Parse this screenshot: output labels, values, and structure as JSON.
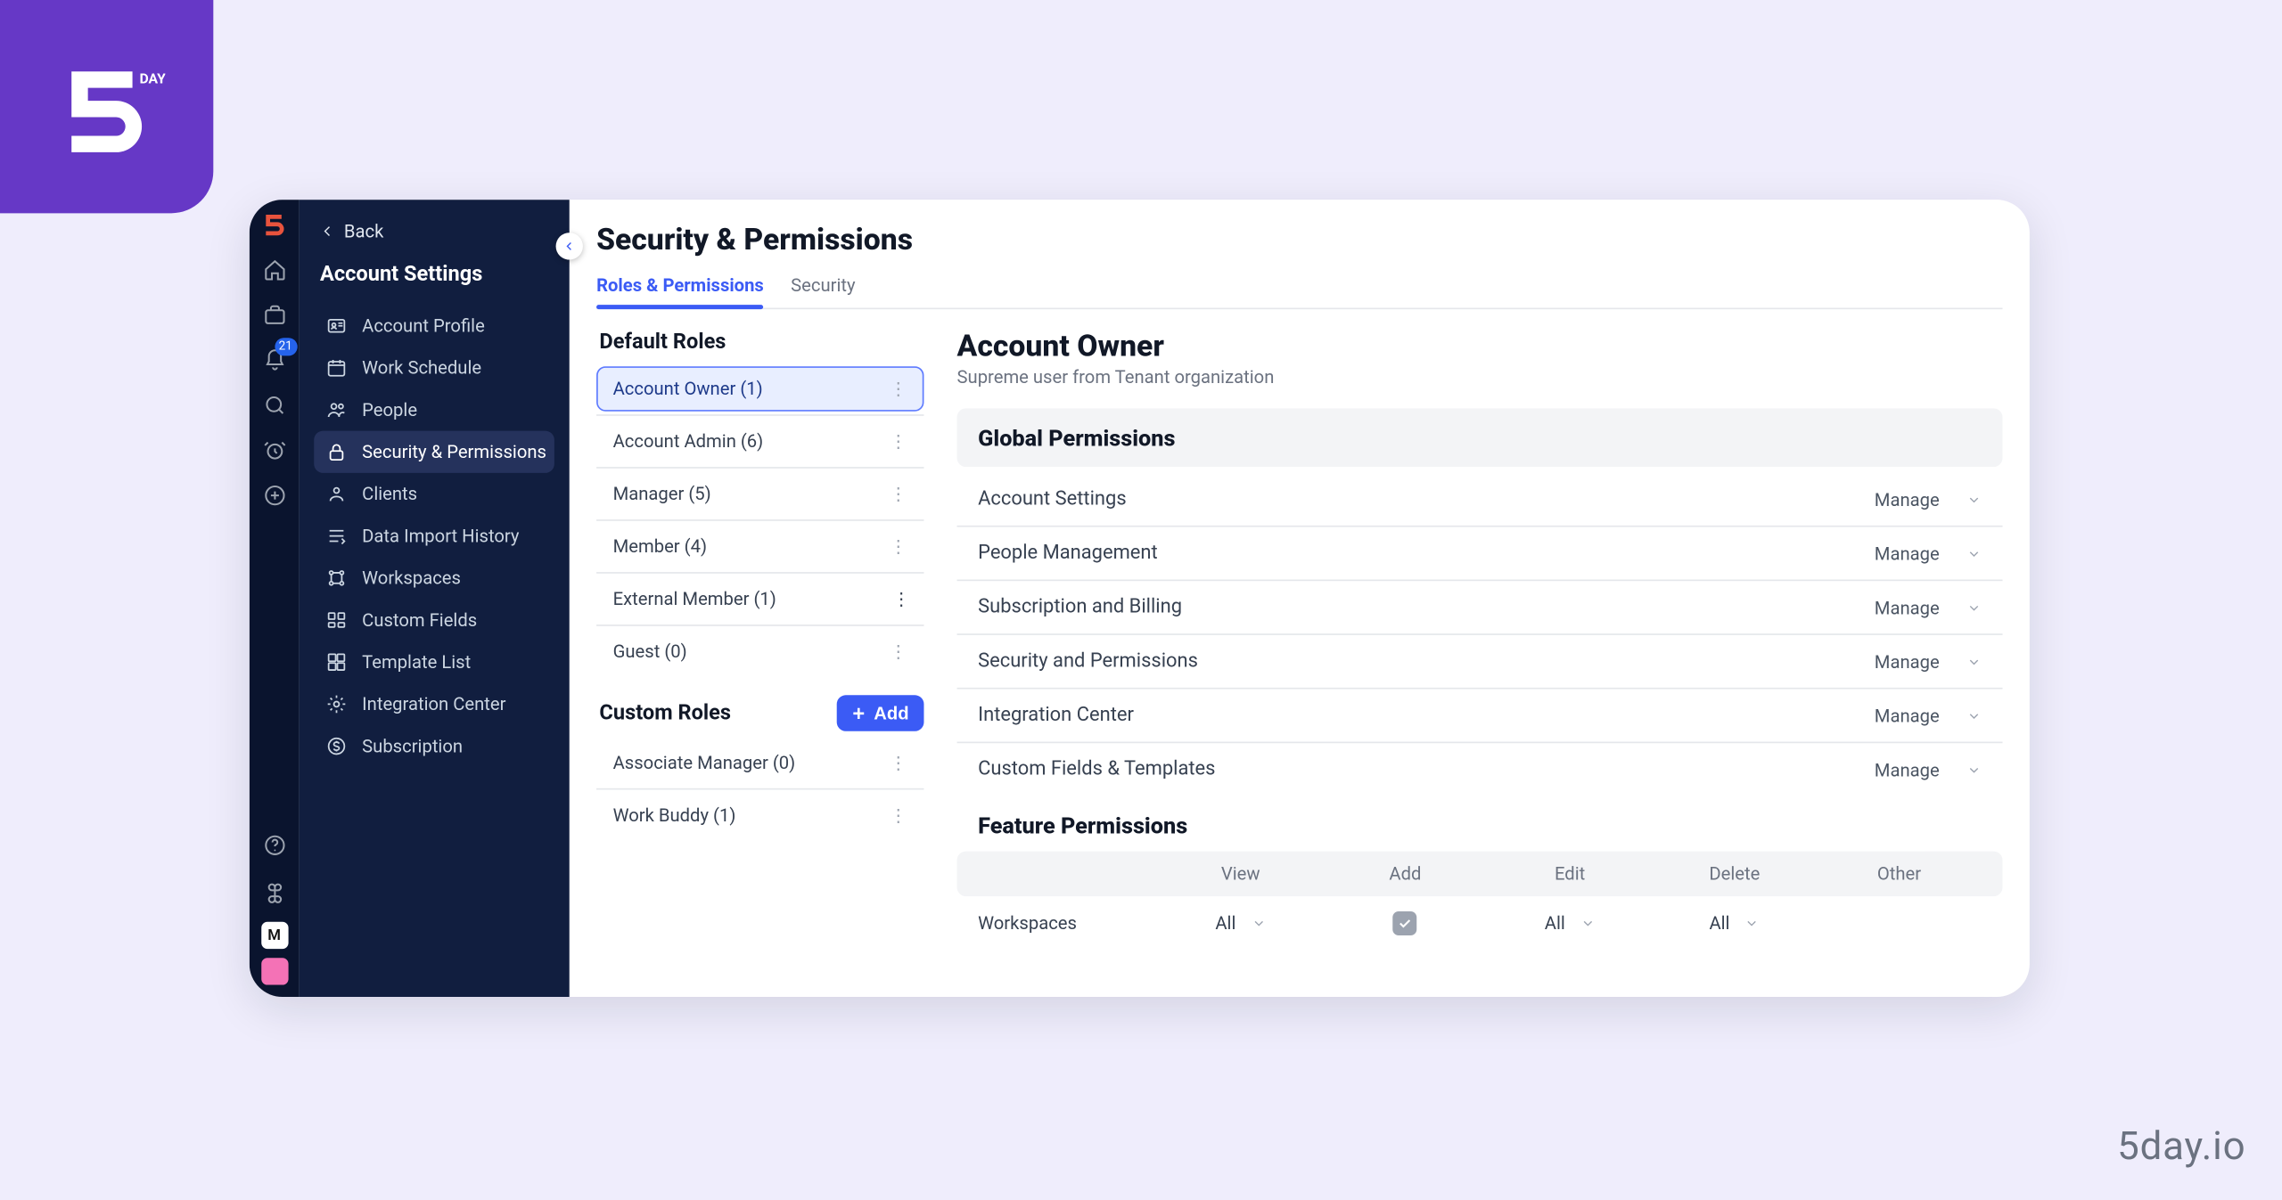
{
  "brand": {
    "name": "5DAY",
    "watermark": "5day.io"
  },
  "iconStrip": {
    "notifBadge": "21",
    "avatarInitial": "M"
  },
  "sidebar": {
    "back": "Back",
    "title": "Account Settings",
    "items": [
      {
        "label": "Account Profile",
        "icon": "id-card-icon"
      },
      {
        "label": "Work Schedule",
        "icon": "calendar-icon"
      },
      {
        "label": "People",
        "icon": "people-icon"
      },
      {
        "label": "Security & Permissions",
        "icon": "lock-icon",
        "active": true
      },
      {
        "label": "Clients",
        "icon": "clients-icon"
      },
      {
        "label": "Data Import History",
        "icon": "import-icon"
      },
      {
        "label": "Workspaces",
        "icon": "workspaces-icon"
      },
      {
        "label": "Custom Fields",
        "icon": "custom-fields-icon"
      },
      {
        "label": "Template List",
        "icon": "templates-icon"
      },
      {
        "label": "Integration Center",
        "icon": "integration-icon"
      },
      {
        "label": "Subscription",
        "icon": "subscription-icon"
      }
    ]
  },
  "page": {
    "title": "Security & Permissions",
    "tabs": [
      {
        "label": "Roles & Permissions",
        "active": true
      },
      {
        "label": "Security"
      }
    ]
  },
  "roles": {
    "defaultHeading": "Default Roles",
    "customHeading": "Custom Roles",
    "addLabel": "Add",
    "default": [
      {
        "label": "Account Owner (1)",
        "selected": true
      },
      {
        "label": "Account Admin (6)"
      },
      {
        "label": "Manager (5)"
      },
      {
        "label": "Member (4)"
      },
      {
        "label": "External Member (1)"
      },
      {
        "label": "Guest (0)"
      }
    ],
    "custom": [
      {
        "label": "Associate Manager (0)"
      },
      {
        "label": "Work Buddy (1)"
      }
    ]
  },
  "detail": {
    "title": "Account Owner",
    "subtitle": "Supreme user from Tenant organization",
    "globalHeading": "Global Permissions",
    "global": [
      {
        "label": "Account Settings",
        "value": "Manage"
      },
      {
        "label": "People Management",
        "value": "Manage"
      },
      {
        "label": "Subscription and Billing",
        "value": "Manage"
      },
      {
        "label": "Security and Permissions",
        "value": "Manage"
      },
      {
        "label": "Integration Center",
        "value": "Manage"
      },
      {
        "label": "Custom Fields & Templates",
        "value": "Manage"
      }
    ],
    "featureHeading": "Feature Permissions",
    "featureColumns": [
      "",
      "View",
      "Add",
      "Edit",
      "Delete",
      "Other"
    ],
    "featureRow": {
      "label": "Workspaces",
      "view": "All",
      "addChecked": true,
      "edit": "All",
      "delete": "All",
      "other": ""
    }
  }
}
